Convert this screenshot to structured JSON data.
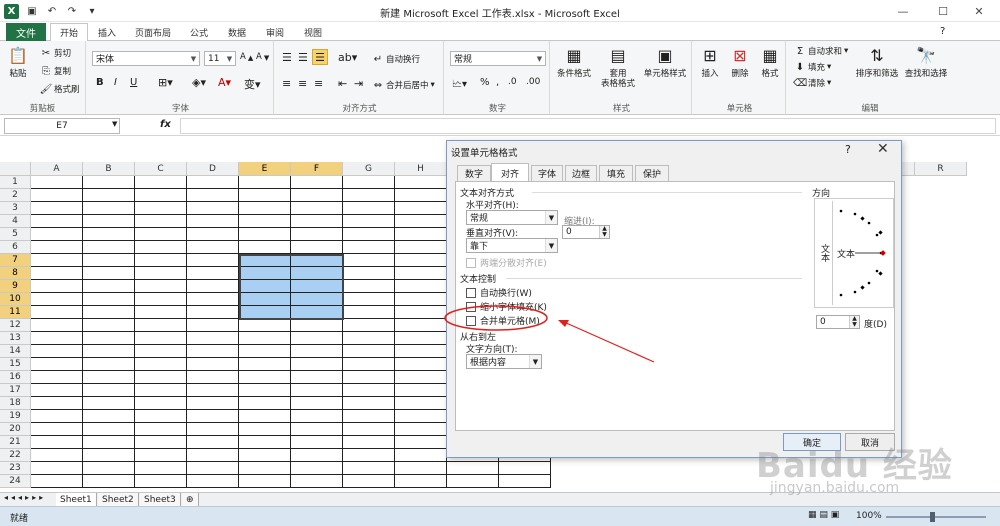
{
  "window": {
    "title": "新建 Microsoft Excel 工作表.xlsx - Microsoft Excel"
  },
  "qat": {
    "logo": "X",
    "icons": [
      "save-icon",
      "undo-icon",
      "redo-icon",
      "customize-icon"
    ]
  },
  "tabs": {
    "file": "文件",
    "items": [
      "开始",
      "插入",
      "页面布局",
      "公式",
      "数据",
      "审阅",
      "视图"
    ],
    "active": "开始"
  },
  "ribbon": {
    "clipboard": {
      "label": "剪贴板",
      "paste": "粘贴",
      "cut": "剪切",
      "copy": "复制",
      "painter": "格式刷"
    },
    "font": {
      "label": "字体",
      "name": "宋体",
      "size": "11",
      "bold": "B",
      "italic": "I",
      "underline": "U"
    },
    "align": {
      "label": "对齐方式",
      "wrap": "自动换行",
      "merge": "合并后居中"
    },
    "number": {
      "label": "数字",
      "format": "常规"
    },
    "styles": {
      "label": "样式",
      "cond": "条件格式",
      "table1": "套用",
      "table2": "表格格式",
      "cellstyle": "单元格样式"
    },
    "cells": {
      "label": "单元格",
      "insert": "插入",
      "delete": "删除",
      "format": "格式"
    },
    "editing": {
      "label": "编辑",
      "autosum": "自动求和",
      "fill": "填充",
      "clear": "清除",
      "sort": "排序和筛选",
      "find": "查找和选择"
    }
  },
  "formula": {
    "namebox": "E7",
    "fx": "fx",
    "value": ""
  },
  "grid": {
    "columns": [
      "A",
      "B",
      "C",
      "D",
      "E",
      "F",
      "G",
      "H",
      "",
      "",
      "",
      "",
      "",
      "",
      "",
      "",
      "",
      "R"
    ],
    "rows": [
      "1",
      "2",
      "3",
      "4",
      "5",
      "6",
      "7",
      "8",
      "9",
      "10",
      "11",
      "12",
      "13",
      "14",
      "15",
      "16",
      "17",
      "18",
      "19",
      "20",
      "21",
      "22",
      "23",
      "24"
    ]
  },
  "sheets": [
    "Sheet1",
    "Sheet2",
    "Sheet3"
  ],
  "status": {
    "ready": "就绪",
    "zoom": "100%"
  },
  "dialog": {
    "title": "设置单元格格式",
    "help": "?",
    "close": "✕",
    "tabs": [
      "数字",
      "对齐",
      "字体",
      "边框",
      "填充",
      "保护"
    ],
    "active_tab": "对齐",
    "text_align": {
      "section": "文本对齐方式",
      "horizontal_label": "水平对齐(H):",
      "horizontal": "常规",
      "indent_label": "缩进(I):",
      "indent": "0",
      "vertical_label": "垂直对齐(V):",
      "vertical": "靠下",
      "distributed": "两端分散对齐(E)"
    },
    "text_control": {
      "section": "文本控制",
      "wrap": "自动换行(W)",
      "shrink": "缩小字体填充(K)",
      "merge": "合并单元格(M)"
    },
    "rtl": {
      "section": "从右到左",
      "direction_label": "文字方向(T):",
      "direction": "根据内容"
    },
    "orientation": {
      "section": "方向",
      "vertical_text": "文本",
      "text": "文本",
      "degrees": "0",
      "degree_label": "度(D)"
    },
    "ok": "确定",
    "cancel": "取消"
  },
  "annotation_color": "#e0201b",
  "watermark": {
    "text": "Baidu 经验",
    "url": "jingyan.baidu.com"
  }
}
